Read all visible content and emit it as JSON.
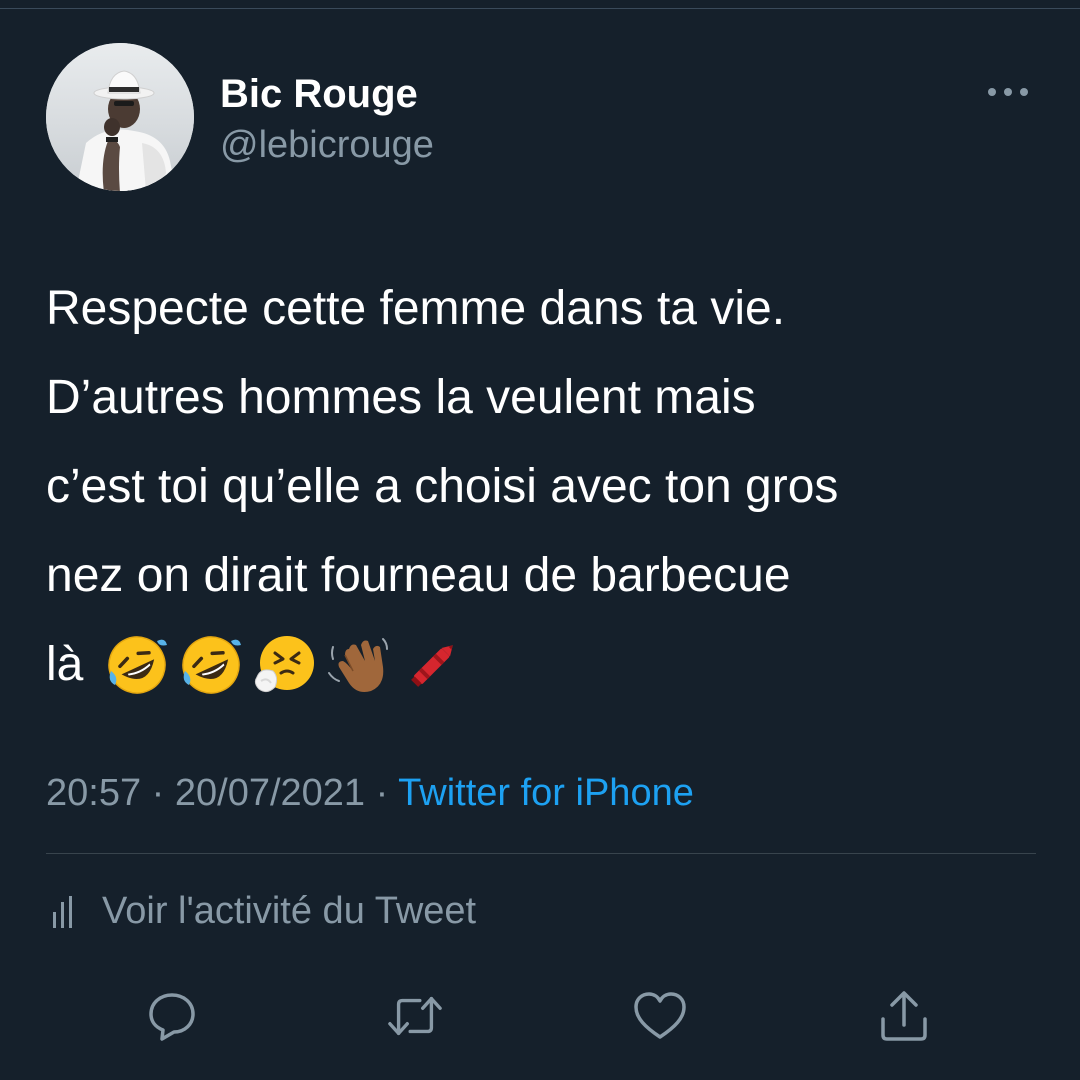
{
  "tweet": {
    "author": {
      "display_name": "Bic Rouge",
      "handle": "@lebicrouge"
    },
    "text_lines": [
      "Respecte cette femme dans ta vie.",
      "D’autres hommes la veulent mais",
      "c’est toi qu’elle a choisi avec ton gros",
      "nez on dirait fourneau de barbecue"
    ],
    "last_line_word": "là",
    "emojis": [
      "rolling-on-floor-laughing",
      "rolling-on-floor-laughing",
      "sneezing-face",
      "waving-hand-medium-dark-skin",
      "crayon"
    ],
    "time": "20:57",
    "separator": "·",
    "date": "20/07/2021",
    "source": "Twitter for iPhone"
  },
  "activity": {
    "label": "Voir l'activité du Tweet",
    "icon": "analytics-bars-icon"
  },
  "actions": [
    {
      "name": "reply",
      "icon": "speech-bubble-icon"
    },
    {
      "name": "retweet",
      "icon": "retweet-arrows-icon"
    },
    {
      "name": "like",
      "icon": "heart-icon"
    },
    {
      "name": "share",
      "icon": "share-upload-icon"
    }
  ],
  "colors": {
    "background": "#15202b",
    "primary_text": "#ffffff",
    "secondary_text": "#8899a6",
    "accent": "#1da1f2",
    "divider": "#38444d"
  }
}
